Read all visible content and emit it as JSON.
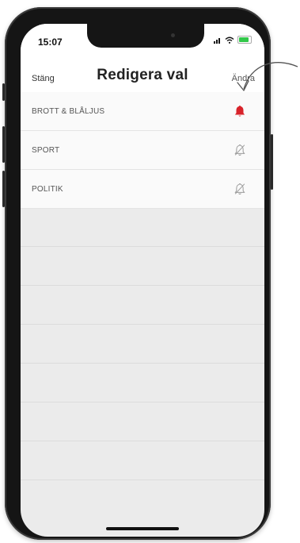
{
  "status_bar": {
    "time": "15:07"
  },
  "nav": {
    "left_label": "Stäng",
    "title": "Redigera val",
    "right_label": "Ändra"
  },
  "items": [
    {
      "label": "BROTT & BLÅLJUS",
      "icon": "bell-filled-icon",
      "active": true
    },
    {
      "label": "SPORT",
      "icon": "bell-slash-icon",
      "active": false
    },
    {
      "label": "POLITIK",
      "icon": "bell-slash-icon",
      "active": false
    }
  ],
  "colors": {
    "accent": "#d8232a",
    "inactive_icon": "#9a9a9a",
    "list_background": "#fafafa",
    "screen_background": "#ebebeb"
  }
}
